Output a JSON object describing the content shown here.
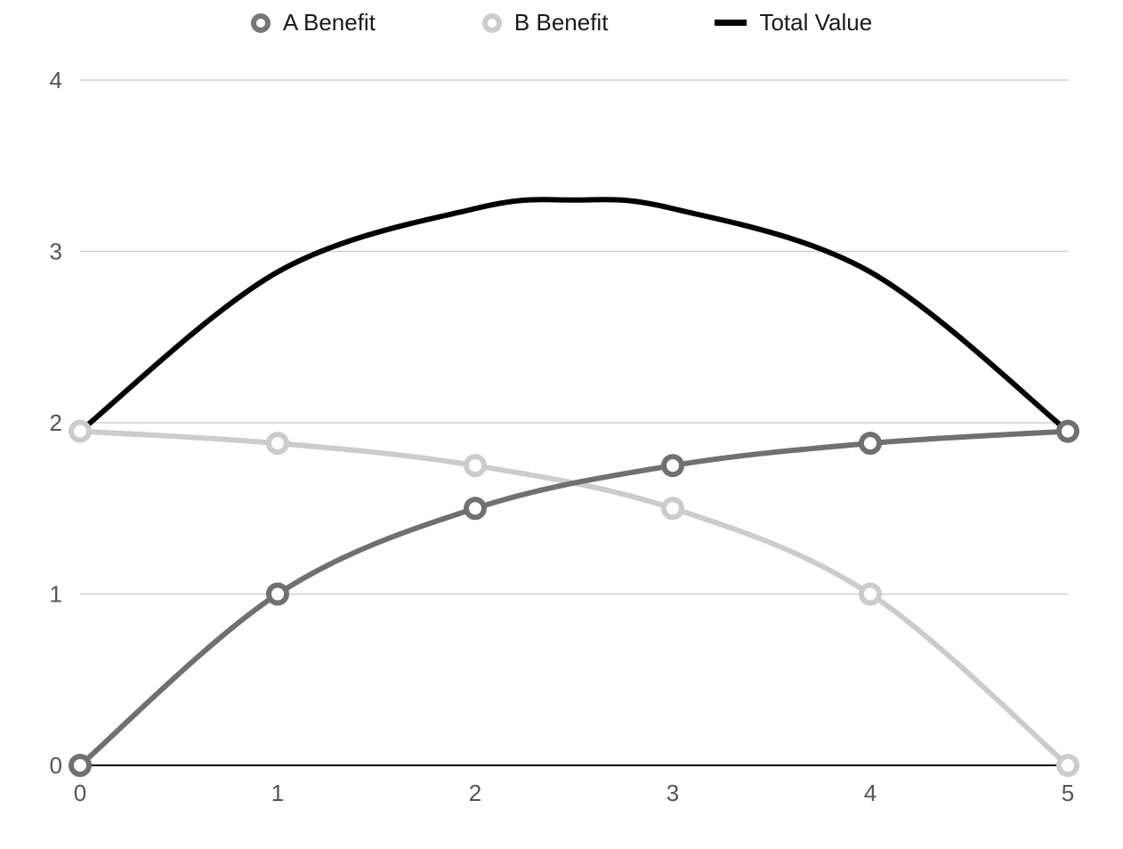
{
  "chart_data": {
    "type": "line",
    "x": [
      0,
      1,
      2,
      3,
      4,
      5
    ],
    "series": [
      {
        "name": "A Benefit",
        "values": [
          0.0,
          1.0,
          1.5,
          1.75,
          1.88,
          1.95
        ],
        "markers": true,
        "color": "#707070"
      },
      {
        "name": "B Benefit",
        "values": [
          1.95,
          1.88,
          1.75,
          1.5,
          1.0,
          0.0
        ],
        "markers": true,
        "color": "#cccccc"
      },
      {
        "name": "Total Value",
        "values": [
          1.95,
          2.88,
          3.25,
          3.25,
          2.88,
          1.95
        ],
        "markers": false,
        "color": "#000000"
      }
    ],
    "x_ticks": [
      0,
      1,
      2,
      3,
      4,
      5
    ],
    "y_ticks": [
      0,
      1,
      2,
      3,
      4
    ],
    "xlim": [
      0,
      5
    ],
    "ylim": [
      0,
      4
    ],
    "grid": {
      "y": true,
      "x": false
    },
    "legend_position": "top",
    "title": "",
    "xlabel": "",
    "ylabel": ""
  },
  "legend": {
    "items": [
      {
        "label": "A Benefit"
      },
      {
        "label": "B Benefit"
      },
      {
        "label": "Total Value"
      }
    ]
  },
  "axes": {
    "x_tick_labels": [
      "0",
      "1",
      "2",
      "3",
      "4",
      "5"
    ],
    "y_tick_labels": [
      "0",
      "1",
      "2",
      "3",
      "4"
    ]
  }
}
